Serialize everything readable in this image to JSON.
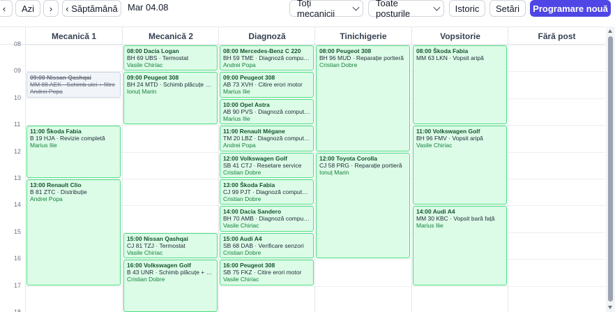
{
  "toolbar": {
    "prev": "‹",
    "today": "Azi",
    "next": "›",
    "week": "‹ Săptămână",
    "date": "Mar 04.08",
    "mechanic_filter": "Toți mecanicii",
    "station_filter": "Toate posturile",
    "history": "Istoric",
    "settings": "Setări",
    "new_appointment": "Programare nouă"
  },
  "columns": [
    "Mecanică 1",
    "Mecanică 2",
    "Diagnoză",
    "Tinichigerie",
    "Vopsitorie",
    "Fără post"
  ],
  "hours": [
    "08",
    "09",
    "10",
    "11",
    "12",
    "13",
    "14",
    "15",
    "16",
    "17",
    "18"
  ],
  "events": [
    {
      "col": 0,
      "start": 9.0,
      "end": 10.0,
      "time": "09:00",
      "car": "Nissan Qashqai",
      "plate": "MM 88 AEK",
      "service": "Schimb ulei + filtre",
      "mechanic": "Andrei Popa",
      "status": "cancelled"
    },
    {
      "col": 0,
      "start": 11.0,
      "end": 13.0,
      "time": "11:00",
      "car": "Škoda Fabia",
      "plate": "B 19 HJA",
      "service": "Revizie completă",
      "mechanic": "Marius Ilie",
      "status": "scheduled"
    },
    {
      "col": 0,
      "start": 13.0,
      "end": 17.0,
      "time": "13:00",
      "car": "Renault Clio",
      "plate": "B 81 ZTC",
      "service": "Distribuție",
      "mechanic": "Andrei Popa",
      "status": "scheduled"
    },
    {
      "col": 1,
      "start": 8.0,
      "end": 9.0,
      "time": "08:00",
      "car": "Dacia Logan",
      "plate": "BH 69 UBS",
      "service": "Termostat",
      "mechanic": "Vasile Chiriac",
      "status": "scheduled"
    },
    {
      "col": 1,
      "start": 9.0,
      "end": 11.0,
      "time": "09:00",
      "car": "Peugeot 308",
      "plate": "BH 24 MTD",
      "service": "Schimb plăcuțe + discuri",
      "mechanic": "Ionuț Marin",
      "status": "scheduled"
    },
    {
      "col": 1,
      "start": 15.0,
      "end": 16.0,
      "time": "15:00",
      "car": "Nissan Qashqai",
      "plate": "CJ 81 TZJ",
      "service": "Termostat",
      "mechanic": "Vasile Chiriac",
      "status": "scheduled"
    },
    {
      "col": 1,
      "start": 16.0,
      "end": 18.0,
      "time": "16:00",
      "car": "Volkswagen Golf",
      "plate": "B 43 UNR",
      "service": "Schimb plăcuțe + discuri",
      "mechanic": "Cristian Dobre",
      "status": "scheduled"
    },
    {
      "col": 2,
      "start": 8.0,
      "end": 9.0,
      "time": "08:00",
      "car": "Mercedes-Benz C 220",
      "plate": "BH 59 TME",
      "service": "Diagnoză computerizată",
      "mechanic": "Andrei Popa",
      "status": "scheduled"
    },
    {
      "col": 2,
      "start": 9.0,
      "end": 10.0,
      "time": "09:00",
      "car": "Peugeot 308",
      "plate": "AB 73 XVH",
      "service": "Citire erori motor",
      "mechanic": "Marius Ilie",
      "status": "scheduled"
    },
    {
      "col": 2,
      "start": 10.0,
      "end": 11.0,
      "time": "10:00",
      "car": "Opel Astra",
      "plate": "AB 90 PVS",
      "service": "Diagnoză computerizată",
      "mechanic": "Marius Ilie",
      "status": "scheduled"
    },
    {
      "col": 2,
      "start": 11.0,
      "end": 12.0,
      "time": "11:00",
      "car": "Renault Mégane",
      "plate": "TM 20 LBZ",
      "service": "Diagnoză computerizată",
      "mechanic": "Andrei Popa",
      "status": "scheduled"
    },
    {
      "col": 2,
      "start": 12.0,
      "end": 13.0,
      "time": "12:00",
      "car": "Volkswagen Golf",
      "plate": "SB 41 CTJ",
      "service": "Resetare service",
      "mechanic": "Cristian Dobre",
      "status": "scheduled"
    },
    {
      "col": 2,
      "start": 13.0,
      "end": 14.0,
      "time": "13:00",
      "car": "Škoda Fabia",
      "plate": "CJ 99 PJT",
      "service": "Diagnoză computerizată",
      "mechanic": "Cristian Dobre",
      "status": "scheduled"
    },
    {
      "col": 2,
      "start": 14.0,
      "end": 15.0,
      "time": "14:00",
      "car": "Dacia Sandero",
      "plate": "BH 70 AMB",
      "service": "Diagnoză computerizată",
      "mechanic": "Vasile Chiriac",
      "status": "scheduled"
    },
    {
      "col": 2,
      "start": 15.0,
      "end": 16.0,
      "time": "15:00",
      "car": "Audi A4",
      "plate": "SB 68 DAB",
      "service": "Verificare senzori",
      "mechanic": "Cristian Dobre",
      "status": "scheduled"
    },
    {
      "col": 2,
      "start": 16.0,
      "end": 17.0,
      "time": "16:00",
      "car": "Peugeot 308",
      "plate": "SB 75 FKZ",
      "service": "Citire erori motor",
      "mechanic": "Vasile Chiriac",
      "status": "scheduled"
    },
    {
      "col": 3,
      "start": 8.0,
      "end": 12.0,
      "time": "08:00",
      "car": "Peugeot 308",
      "plate": "BH 96 MUD",
      "service": "Reparație portieră",
      "mechanic": "Cristian Dobre",
      "status": "scheduled"
    },
    {
      "col": 3,
      "start": 12.0,
      "end": 16.0,
      "time": "12:00",
      "car": "Toyota Corolla",
      "plate": "CJ 58 PRG",
      "service": "Reparație portieră",
      "mechanic": "Ionuț Marin",
      "status": "scheduled"
    },
    {
      "col": 4,
      "start": 8.0,
      "end": 11.0,
      "time": "08:00",
      "car": "Škoda Fabia",
      "plate": "MM 63 LKN",
      "service": "Vopsit aripă",
      "mechanic": "",
      "status": "scheduled"
    },
    {
      "col": 4,
      "start": 11.0,
      "end": 14.0,
      "time": "11:00",
      "car": "Volkswagen Golf",
      "plate": "BH 96 FMV",
      "service": "Vopsit aripă",
      "mechanic": "Vasile Chiriac",
      "status": "scheduled"
    },
    {
      "col": 4,
      "start": 14.0,
      "end": 17.0,
      "time": "14:00",
      "car": "Audi A4",
      "plate": "MM 30 KBC",
      "service": "Vopsit bară față",
      "mechanic": "Marius Ilie",
      "status": "scheduled"
    }
  ]
}
